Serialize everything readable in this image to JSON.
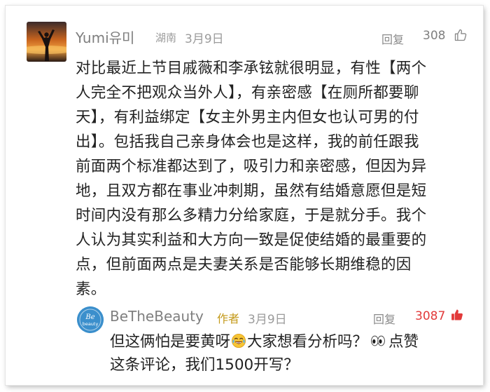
{
  "main_comment": {
    "username": "Yumi유미",
    "location": "湖南",
    "date": "3月9日",
    "reply_label": "回复",
    "likes": "308",
    "body_lines": [
      "对比最近上节目戚薇和李承铉就很明显，有性【两个",
      "人完全不把观众当外人】，有亲密感【在厕所都要聊",
      "天】，有利益绑定【女主外男主内但女也认可男的付",
      "出】。包括我自己亲身体会也是这样，我的前任跟我",
      "前面两个标准都达到了，吸引力和亲密感，但因为异",
      "地，且双方都在事业冲刺期，虽然有结婚意愿但是短",
      "时间内没有那么多精力分给家庭，于是就分手。我个",
      "人认为其实利益和大方向一致是促使结婚的最重要的",
      "点，但前面两点是夫妻关系是否能够长期维稳的因",
      "素。"
    ],
    "avatar_icon": "sunset-silhouette-avatar",
    "like_icon": "thumbs-up-outline-icon"
  },
  "reply_comment": {
    "username": "BeTheBeauty",
    "author_badge": "作者",
    "date": "3月9日",
    "reply_label": "回复",
    "likes": "3087",
    "line1_part1": "但这俩怕是要黄呀",
    "line1_part2": "大家想看分析吗？",
    "line1_part3": "点赞",
    "line2": "这条评论，我们1500开写？",
    "avatar_text_top": "Be",
    "avatar_text_bottom": "beauty",
    "like_icon": "thumbs-up-filled-red-icon",
    "emoji_1": "laughing-tears-emoji",
    "emoji_2": "eyes-emoji",
    "likes_color": "#e23a3a"
  }
}
